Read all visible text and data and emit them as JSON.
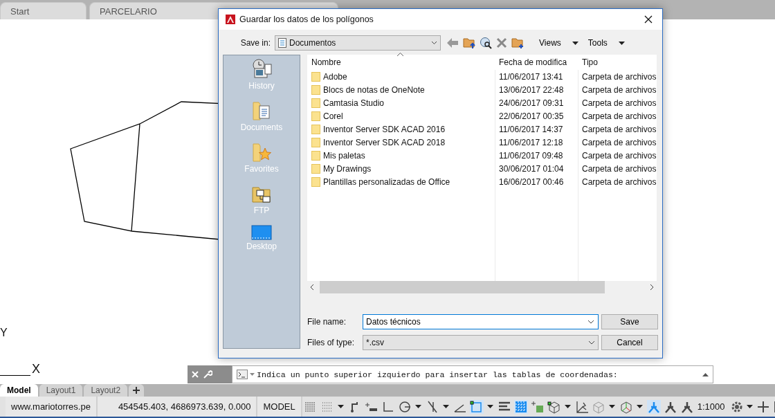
{
  "doc_tabs": [
    {
      "label": "Start",
      "selected": false
    },
    {
      "label": "PARCELARIO",
      "selected": false
    }
  ],
  "ucs": {
    "y_label": "Y",
    "x_label": "X"
  },
  "dialog": {
    "title": "Guardar los datos de los polígonos",
    "save_in_label": "Save in:",
    "save_in": "Documentos",
    "views": "Views",
    "tools": "Tools",
    "places": [
      {
        "label": "History",
        "kind": "history"
      },
      {
        "label": "Documents",
        "kind": "documents"
      },
      {
        "label": "Favorites",
        "kind": "favorites"
      },
      {
        "label": "FTP",
        "kind": "ftp"
      },
      {
        "label": "Desktop",
        "kind": "desktop"
      }
    ],
    "columns": [
      "Nombre",
      "Fecha de modifica",
      "Tipo"
    ],
    "files": [
      {
        "name": "Adobe",
        "date": "11/06/2017 13:41",
        "type": "Carpeta de archivos"
      },
      {
        "name": "Blocs de notas de OneNote",
        "date": "13/06/2017 22:48",
        "type": "Carpeta de archivos"
      },
      {
        "name": "Camtasia Studio",
        "date": "24/06/2017 09:31",
        "type": "Carpeta de archivos"
      },
      {
        "name": "Corel",
        "date": "22/06/2017 00:35",
        "type": "Carpeta de archivos"
      },
      {
        "name": "Inventor Server SDK ACAD 2016",
        "date": "11/06/2017 14:37",
        "type": "Carpeta de archivos"
      },
      {
        "name": "Inventor Server SDK ACAD 2018",
        "date": "11/06/2017 12:18",
        "type": "Carpeta de archivos"
      },
      {
        "name": "Mis paletas",
        "date": "11/06/2017 09:48",
        "type": "Carpeta de archivos"
      },
      {
        "name": "My Drawings",
        "date": "30/06/2017 01:04",
        "type": "Carpeta de archivos"
      },
      {
        "name": "Plantillas personalizadas de Office",
        "date": "16/06/2017 00:46",
        "type": "Carpeta de archivos"
      }
    ],
    "file_name_label": "File name:",
    "file_name": "Datos técnicos",
    "file_type_label": "Files of type:",
    "file_type": "*.csv",
    "save": "Save",
    "cancel": "Cancel"
  },
  "command_line": {
    "text": "Indica un punto superior izquierdo para insertar las tablas de coordenadas:"
  },
  "layout_tabs": [
    {
      "label": "Model",
      "selected": true
    },
    {
      "label": "Layout1",
      "selected": false
    },
    {
      "label": "Layout2",
      "selected": false
    }
  ],
  "status_bar": {
    "website": "www.mariotorres.pe",
    "coordinates": "454545.403, 4686973.639, 0.000",
    "space": "MODEL",
    "scale": "1:1000",
    "tools": [
      {
        "kind": "grid",
        "on": false
      },
      {
        "kind": "snap",
        "on": false,
        "dropdown": true
      },
      {
        "kind": "ortho",
        "on": false
      },
      {
        "kind": "dynin",
        "on": false
      },
      {
        "kind": "iso",
        "on": false
      },
      {
        "kind": "polar",
        "on": false,
        "dropdown": true
      },
      {
        "kind": "track",
        "on": false,
        "dropdown": true
      },
      {
        "kind": "angle",
        "on": false
      },
      {
        "kind": "osnap",
        "on": true,
        "dropdown": true
      },
      {
        "kind": "lineweight",
        "on": false
      },
      {
        "kind": "transparency",
        "on": true
      },
      {
        "kind": "cycling",
        "on": false
      },
      {
        "kind": "cube",
        "on": false,
        "dropdown": true
      },
      {
        "kind": "ucs",
        "on": false
      },
      {
        "kind": "filter",
        "on": false,
        "dropdown": true
      },
      {
        "kind": "gizmo",
        "on": false,
        "dropdown": true
      },
      {
        "kind": "annovis",
        "on": true
      },
      {
        "kind": "autoscale",
        "on": false
      },
      {
        "kind": "annoscale",
        "on": false
      }
    ]
  }
}
